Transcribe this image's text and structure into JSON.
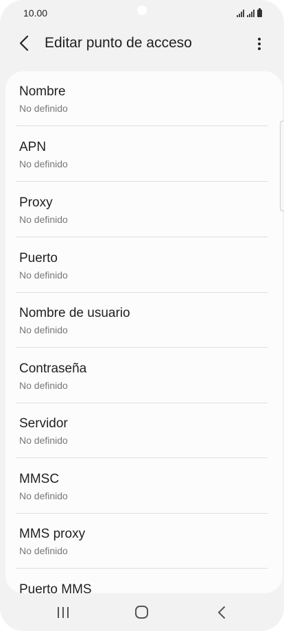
{
  "status_bar": {
    "time": "10.00",
    "icons": [
      "signal-sim1-icon",
      "signal-sim2-icon",
      "battery-icon"
    ]
  },
  "header": {
    "title": "Editar punto de acceso",
    "back_icon": "chevron-left-icon",
    "more_icon": "more-vertical-icon"
  },
  "items": [
    {
      "title": "Nombre",
      "value": "No definido"
    },
    {
      "title": "APN",
      "value": "No definido"
    },
    {
      "title": "Proxy",
      "value": "No definido"
    },
    {
      "title": "Puerto",
      "value": "No definido"
    },
    {
      "title": "Nombre de usuario",
      "value": "No definido"
    },
    {
      "title": "Contraseña",
      "value": "No definido"
    },
    {
      "title": "Servidor",
      "value": "No definido"
    },
    {
      "title": "MMSC",
      "value": "No definido"
    },
    {
      "title": "MMS proxy",
      "value": "No definido"
    },
    {
      "title": "Puerto MMS",
      "value": ""
    }
  ],
  "nav_bar": {
    "icons": [
      "recent-apps-icon",
      "home-icon",
      "back-icon"
    ]
  }
}
